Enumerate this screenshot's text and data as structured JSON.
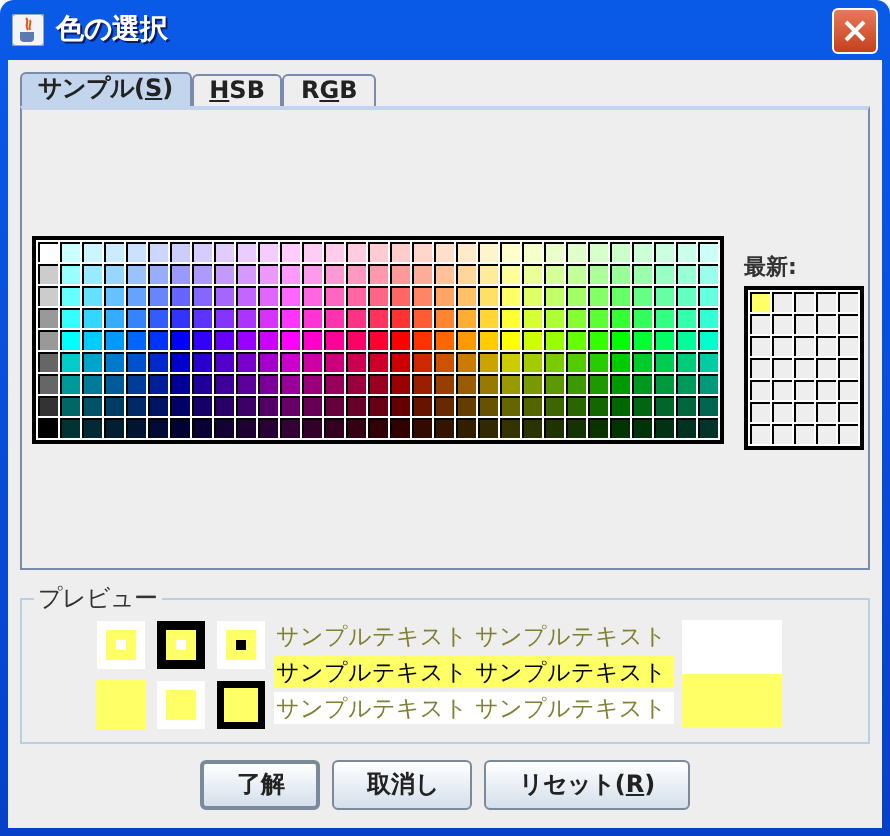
{
  "window": {
    "title": "色の選択"
  },
  "tabs": [
    {
      "label_parts": [
        {
          "text": "サンプル(",
          "underline": false
        },
        {
          "text": "S",
          "underline": true
        },
        {
          "text": ")",
          "underline": false
        }
      ],
      "selected": true
    },
    {
      "label_parts": [
        {
          "text": "H",
          "underline": true
        },
        {
          "text": "SB",
          "underline": false
        }
      ],
      "selected": false
    },
    {
      "label_parts": [
        {
          "text": "R",
          "underline": false
        },
        {
          "text": "G",
          "underline": true
        },
        {
          "text": "B",
          "underline": false
        }
      ],
      "selected": false
    }
  ],
  "recent": {
    "label": "最新:",
    "swatches": [
      {
        "color": "#ffff66"
      }
    ]
  },
  "preview": {
    "title": "プレビュー",
    "color": "#ffff66",
    "sample_text": [
      "サンプルテキスト サンプルテキスト",
      "サンプルテキスト サンプルテキスト",
      "サンプルテキスト サンプルテキスト"
    ]
  },
  "buttons": [
    {
      "label_parts": [
        {
          "text": "了解",
          "underline": false
        }
      ],
      "focused": true
    },
    {
      "label_parts": [
        {
          "text": "取消し",
          "underline": false
        }
      ],
      "focused": false
    },
    {
      "label_parts": [
        {
          "text": "リセット(",
          "underline": false
        },
        {
          "text": "R",
          "underline": true
        },
        {
          "text": ")",
          "underline": false
        }
      ],
      "focused": false
    }
  ]
}
